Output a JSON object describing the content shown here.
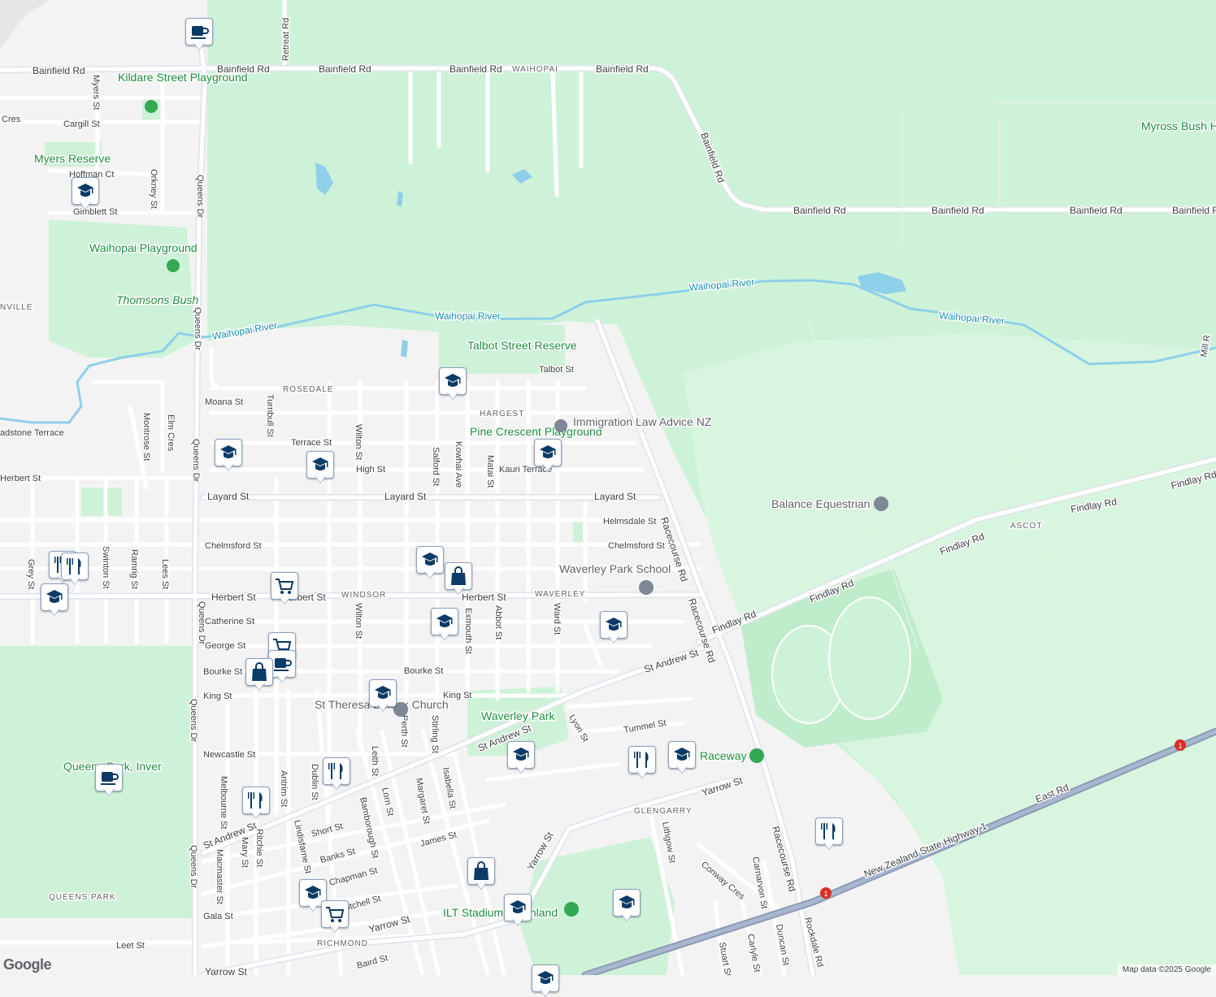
{
  "map": {
    "attribution": "Map data ©2025 Google",
    "logo": "Google"
  },
  "colors": {
    "land": "#f3f3f4",
    "park": "#cef2d8",
    "park_dark": "#b9e8c6",
    "water": "#8ecfe9",
    "road": "#ffffff",
    "arterial": "#dde2ea",
    "highway": "#8c9bb5",
    "marker_icon": "#0b3a66"
  },
  "labels": {
    "bainfield_rd": "Bainfield Rd",
    "waihopai": "WAIHOPAI",
    "retreat_rd": "Retreat Rd",
    "kildare_playground": "Kildare Street Playground",
    "myers_st": "Myers St",
    "cargill_st": "Cargill St",
    "cres": "Cres",
    "myers_reserve": "Myers Reserve",
    "hoffman_ct": "Hoffman Ct",
    "orkney_st": "Orkney St",
    "gimblett_st": "Gimblett St",
    "queens_dr": "Queens Dr",
    "waihopai_playground": "Waihopai Playground",
    "thomsons_bush": "Thomsons Bush",
    "nville": "NVILLE",
    "waihopai_river": "Waihopai River",
    "myross_bush": "Myross Bush H",
    "mill_rd": "Mill R",
    "talbot_reserve": "Talbot Street Reserve",
    "talbot_st": "Talbot St",
    "rosedale": "ROSEDALE",
    "moana_st": "Moana St",
    "hargest": "HARGEST",
    "turnbull_st": "Turnbull St",
    "montrose_st": "Montrose St",
    "elm_cres": "Elm Cres",
    "gladstone_terrace": "adstone Terrace",
    "terrace_st": "Terrace St",
    "wilton_st": "Wilton St",
    "salford_st": "Salford St",
    "kowhai_ave": "Kowhai Ave",
    "matai_st": "Matai St",
    "pine_crescent_playground": "Pine Crescent Playground",
    "immigration_law": "Immigration Law Advice NZ",
    "high_st": "High St",
    "kauri_terrace": "Kauri Terrace",
    "herbert_st": "Herbert St",
    "layard_st": "Layard St",
    "helmsdale_st": "Helmsdale St",
    "racecourse_rd": "Racecourse Rd",
    "balance_equestrian": "Balance Equestrian",
    "findlay_rd": "Findlay Rd",
    "ascot": "ASCOT",
    "chelmsford_st": "Chelmsford St",
    "grey_st": "Grey St",
    "swinton_st": "Swinton St",
    "ramrig_st": "Ramrig St",
    "lees_st": "Lees St",
    "waverley_park_school": "Waverley Park School",
    "windsor": "WINDSOR",
    "waverley": "WAVERLEY",
    "abbot_st": "Abbot St",
    "ward_st": "Ward St",
    "exmouth_st": "Exmouth St",
    "catherine_st": "Catherine St",
    "george_st": "George St",
    "bourke_st": "Bourke St",
    "king_st": "King St",
    "st_andrew_st": "St Andrew St",
    "st_theresa": "St Theresa Lisieux Church",
    "waverley_park": "Waverley Park",
    "lyon_st": "Lyon St",
    "tummel_st": "Tummel St",
    "perth_st": "Perth St",
    "stirling_st": "Stirling St",
    "leith_st": "Leith St",
    "newcastle_st": "Newcastle St",
    "isabella_st": "Isabella St",
    "margaret_st": "Margaret St",
    "lorn_st": "Lorn St",
    "bamborough_st": "Bamborough St",
    "dublin_st": "Dublin St",
    "antrim_st": "Antrim St",
    "ritchie_st": "Ritchie St",
    "melbourne_st": "Melbourne St",
    "macmaster_st": "Macmaster St",
    "mary_st": "Mary St",
    "lindisfarne_st": "Lindisfarne St",
    "short_st": "Short St",
    "banks_st": "Banks St",
    "james_st": "James St",
    "chapman_st": "Chapman St",
    "mitchell_st": "Mitchell St",
    "gala_st": "Gala St",
    "richmond": "RICHMOND",
    "yarrow_st": "Yarrow St",
    "leet_st": "Leet St",
    "baird_st": "Baird St",
    "queens_park": "QUEENS PARK",
    "queens_park_label": "Queens Park, Inver",
    "glengarry": "GLENGARRY",
    "lithgow_st": "Lithgow St",
    "conway_cres": "Conway Cres",
    "carnarvon_st": "Carnarvon St",
    "duncan_st": "Duncan St",
    "carlyle_st": "Carlyle St",
    "stuart_st": "Stuart St",
    "rockdale_rd": "Rockdale Rd",
    "raceway": "Raceway",
    "ilt_stadium": "ILT Stadium Southland",
    "nz_sh1": "New Zealand State Highway 1",
    "east_rd": "East Rd",
    "sh1_shield": "1"
  },
  "markers": [
    {
      "icon": "coffee-icon"
    },
    {
      "icon": "school-icon"
    },
    {
      "icon": "school-icon"
    },
    {
      "icon": "school-icon"
    },
    {
      "icon": "school-icon"
    },
    {
      "icon": "school-icon"
    },
    {
      "icon": "restaurant-icon"
    },
    {
      "icon": "school-icon"
    },
    {
      "icon": "restaurant-icon"
    },
    {
      "icon": "grocery-icon"
    },
    {
      "icon": "school-icon"
    },
    {
      "icon": "shopping-bag-icon"
    },
    {
      "icon": "school-icon"
    },
    {
      "icon": "school-icon"
    },
    {
      "icon": "grocery-icon"
    },
    {
      "icon": "coffee-icon"
    },
    {
      "icon": "shopping-bag-icon"
    },
    {
      "icon": "school-icon"
    },
    {
      "icon": "school-icon"
    },
    {
      "icon": "restaurant-icon"
    },
    {
      "icon": "school-icon"
    },
    {
      "icon": "coffee-icon"
    },
    {
      "icon": "restaurant-icon"
    },
    {
      "icon": "restaurant-icon"
    },
    {
      "icon": "shopping-bag-icon"
    },
    {
      "icon": "school-icon"
    },
    {
      "icon": "grocery-icon"
    },
    {
      "icon": "school-icon"
    },
    {
      "icon": "school-icon"
    },
    {
      "icon": "restaurant-icon"
    },
    {
      "icon": "school-icon"
    }
  ]
}
